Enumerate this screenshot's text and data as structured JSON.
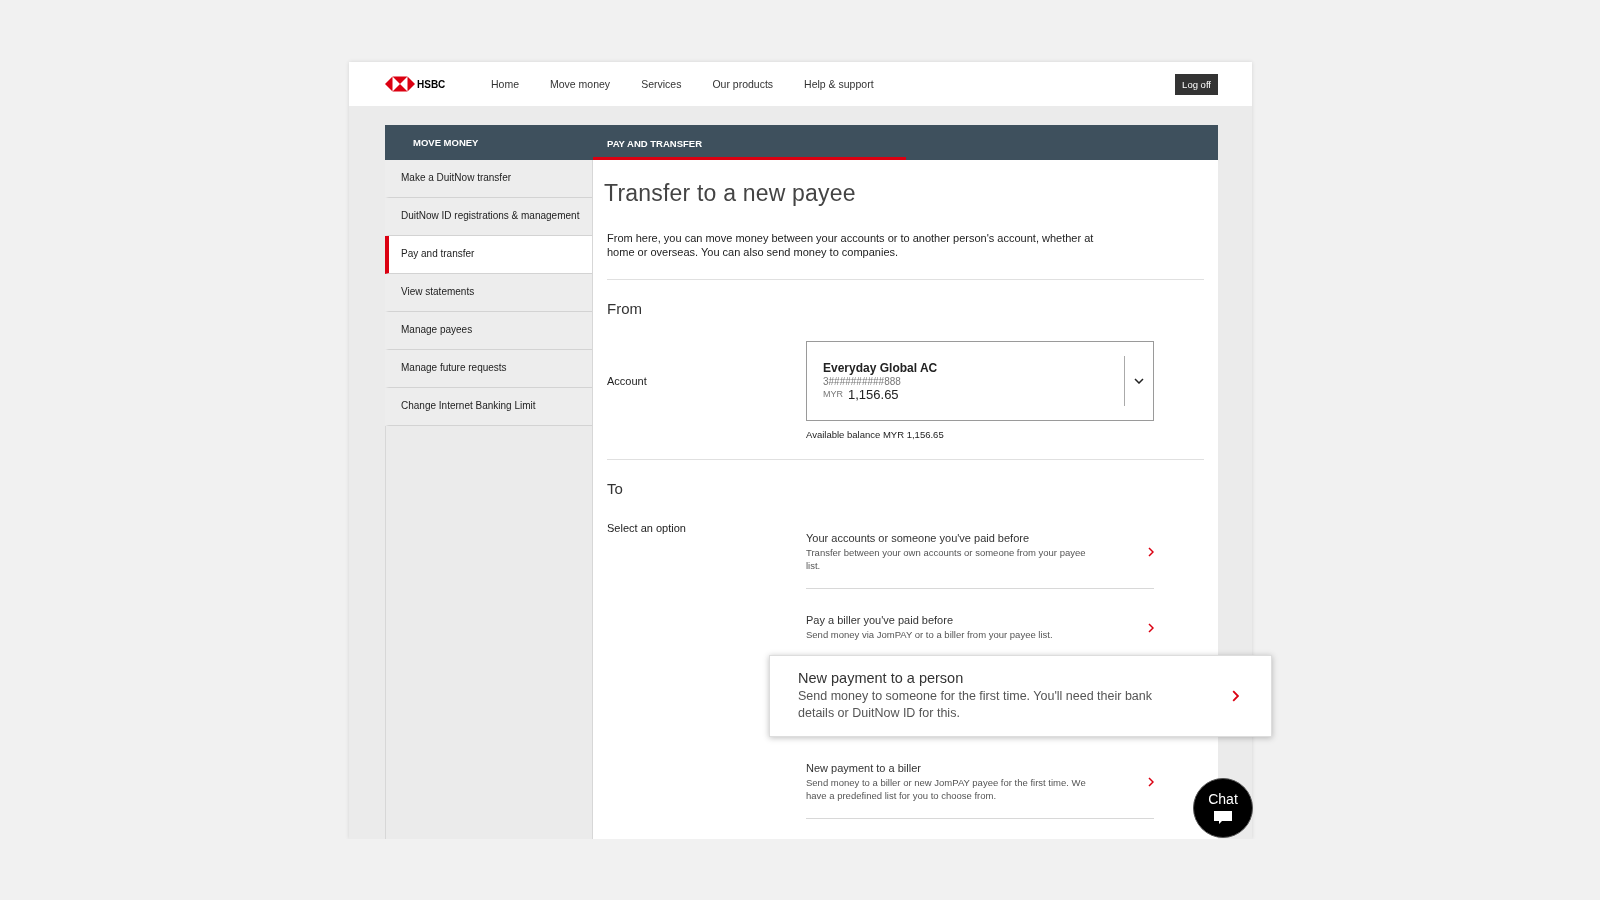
{
  "header": {
    "logo_text": "HSBC",
    "nav": [
      "Home",
      "Move money",
      "Services",
      "Our products",
      "Help & support"
    ],
    "log_off": "Log off"
  },
  "section_bar": {
    "title": "MOVE MONEY",
    "tabs": [
      {
        "label": "PAY AND TRANSFER",
        "selected": true
      }
    ]
  },
  "sidebar": {
    "items": [
      {
        "label": "Make a DuitNow transfer",
        "selected": false
      },
      {
        "label": "DuitNow ID registrations & management",
        "selected": false
      },
      {
        "label": "Pay and transfer",
        "selected": true
      },
      {
        "label": "View statements",
        "selected": false
      },
      {
        "label": "Manage payees",
        "selected": false
      },
      {
        "label": "Manage future requests",
        "selected": false
      },
      {
        "label": "Change Internet Banking Limit",
        "selected": false
      }
    ]
  },
  "page": {
    "title": "Transfer to a new payee",
    "description": "From here, you can move money between your accounts or to another person's account, whether at home or overseas. You can also send money to companies."
  },
  "from": {
    "heading": "From",
    "label": "Account",
    "account": {
      "name": "Everyday Global AC",
      "number": "3##########888",
      "currency": "MYR",
      "amount": "1,156.65"
    },
    "available_balance": "Available balance MYR 1,156.65"
  },
  "to": {
    "heading": "To",
    "label": "Select an option",
    "options": [
      {
        "title": "Your accounts or someone you've paid before",
        "description": "Transfer between your own accounts or someone from your payee list.",
        "highlighted": false
      },
      {
        "title": "Pay a biller you've paid before",
        "description": "Send money via JomPAY or to a biller from your payee list.",
        "highlighted": false
      },
      {
        "title": "New payment to a person",
        "description": "Send money to someone for the first time. You'll need their bank details or DuitNow ID for this.",
        "highlighted": true
      },
      {
        "title": "New payment to a biller",
        "description": "Send money to a biller or new JomPAY payee for the first time. We have a predefined list for you to choose from.",
        "highlighted": false
      }
    ]
  },
  "chat": {
    "label": "Chat"
  }
}
